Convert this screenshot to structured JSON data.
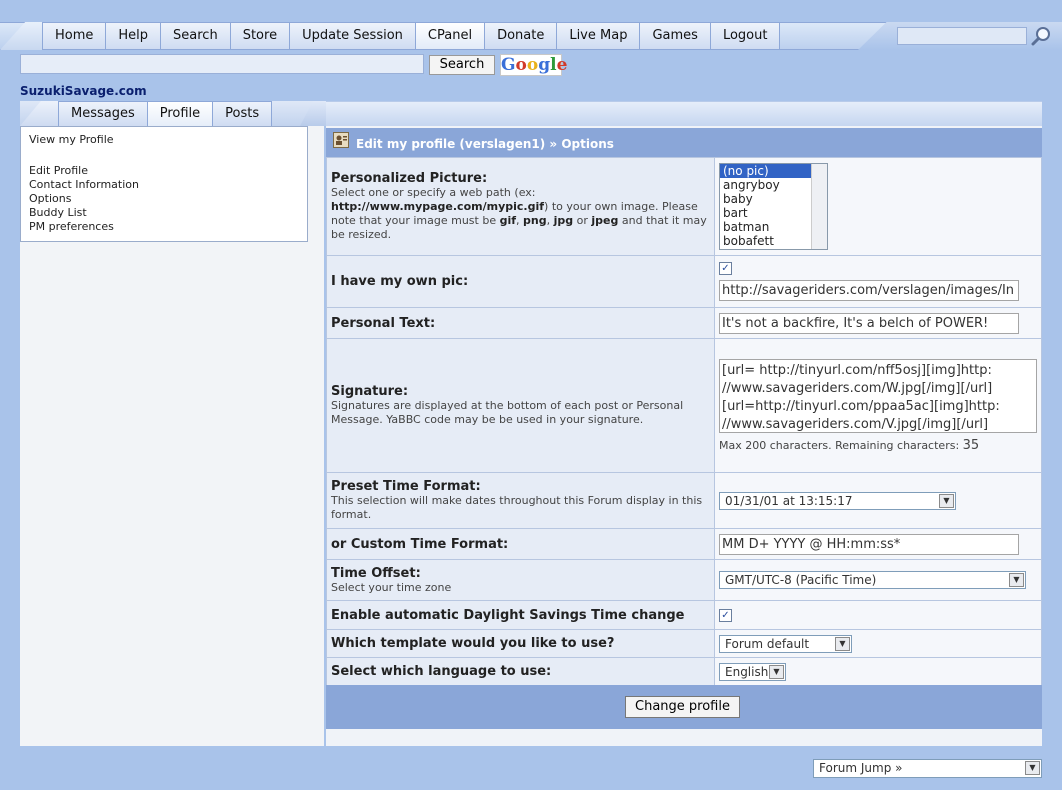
{
  "topnav": {
    "tabs": [
      "Home",
      "Help",
      "Search",
      "Store",
      "Update Session",
      "CPanel",
      "Donate",
      "Live Map",
      "Games",
      "Logout"
    ],
    "active_tab": "CPanel"
  },
  "google": {
    "button_label": "Search",
    "logo_text": "Google"
  },
  "site_title": "SuzukiSavage.com",
  "subnav": {
    "tabs": [
      "Messages",
      "Profile",
      "Posts"
    ],
    "active_tab": "Profile"
  },
  "left_menu": {
    "view_profile": "View my Profile",
    "items": [
      "Edit Profile",
      "Contact Information",
      "Options",
      "Buddy List",
      "PM preferences"
    ]
  },
  "main": {
    "title": "Edit my profile (verslagen1) » Options",
    "picture": {
      "label": "Personalized Picture:",
      "desc_1": "Select one or specify a web path (ex: ",
      "desc_path": "http://www.mypage.com/mypic.gif",
      "desc_2": ") to your own image. Please note that your image must be ",
      "fmt_gif": "gif",
      "fmt_png": "png",
      "fmt_jpg": "jpg",
      "fmt_jpeg": "jpeg",
      "comma": ", ",
      "or": " or ",
      "desc_3": " and that it may be resized.",
      "options": [
        "(no pic)",
        "angryboy",
        "baby",
        "bart",
        "batman",
        "bobafett"
      ],
      "selected": "(no pic)"
    },
    "own_pic": {
      "label": "I have my own pic:",
      "checked": "✓",
      "url": "http://savageriders.com/verslagen/images/In"
    },
    "personal_text": {
      "label": "Personal Text:",
      "value": "It's not a backfire, It's a belch of POWER!"
    },
    "signature": {
      "label": "Signature:",
      "desc": "Signatures are displayed at the bottom of each post or Personal Message. YaBBC code may be be used in your signature.",
      "lines": [
        "[url= http://tinyurl.com/nff5osj][img]http:",
        "//www.savageriders.com/W.jpg[/img][/url]",
        "[url=http://tinyurl.com/ppaa5ac][img]http:",
        "//www.savageriders.com/V.jpg[/img][/url]"
      ],
      "hint": "Max 200 characters. Remaining characters: ",
      "remaining": "35"
    },
    "preset_time": {
      "label": "Preset Time Format:",
      "desc": "This selection will make dates throughout this Forum display in this format.",
      "value": "01/31/01 at 13:15:17"
    },
    "custom_time": {
      "label": "or Custom Time Format:",
      "value": "MM D+ YYYY @ HH:mm:ss*"
    },
    "time_offset": {
      "label": "Time Offset:",
      "desc": "Select your time zone",
      "value": "GMT/UTC-8 (Pacific Time)"
    },
    "dst": {
      "label": "Enable automatic Daylight Savings Time change",
      "checked": "✓"
    },
    "template": {
      "label": "Which template would you like to use?",
      "value": "Forum default"
    },
    "language": {
      "label": "Select which language to use:",
      "value": "English"
    },
    "submit_label": "Change profile"
  },
  "forum_jump": "Forum Jump »",
  "icons": {
    "search": "magnifier-icon",
    "profile": "profile-card-icon",
    "dropdown": "dropdown-arrow-icon"
  }
}
